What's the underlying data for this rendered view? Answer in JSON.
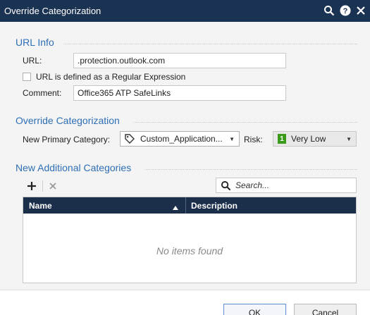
{
  "window": {
    "title": "Override Categorization"
  },
  "url_info": {
    "section_title": "URL Info",
    "url_label": "URL:",
    "url_value": ".protection.outlook.com",
    "regex_checkbox_label": "URL is defined as a Regular Expression",
    "regex_checked": false,
    "comment_label": "Comment:",
    "comment_value": "Office365 ATP SafeLinks"
  },
  "override": {
    "section_title": "Override Categorization",
    "primary_category_label": "New Primary Category:",
    "primary_category_value": "Custom_Application...",
    "category_icon": "tag-icon",
    "risk_label": "Risk:",
    "risk_level": "1",
    "risk_value": "Very Low",
    "risk_color": "#3a9a1a"
  },
  "additional": {
    "section_title": "New Additional Categories",
    "add_icon": "plus-icon",
    "remove_icon": "close-icon",
    "search_placeholder": "Search...",
    "columns": [
      "Name",
      "Description"
    ],
    "empty_text": "No items found"
  },
  "footer": {
    "ok_label": "OK",
    "cancel_label": "Cancel"
  },
  "colors": {
    "titlebar": "#1b3353",
    "section_title": "#2e6fb5",
    "grid_header": "#1c2f4a"
  }
}
